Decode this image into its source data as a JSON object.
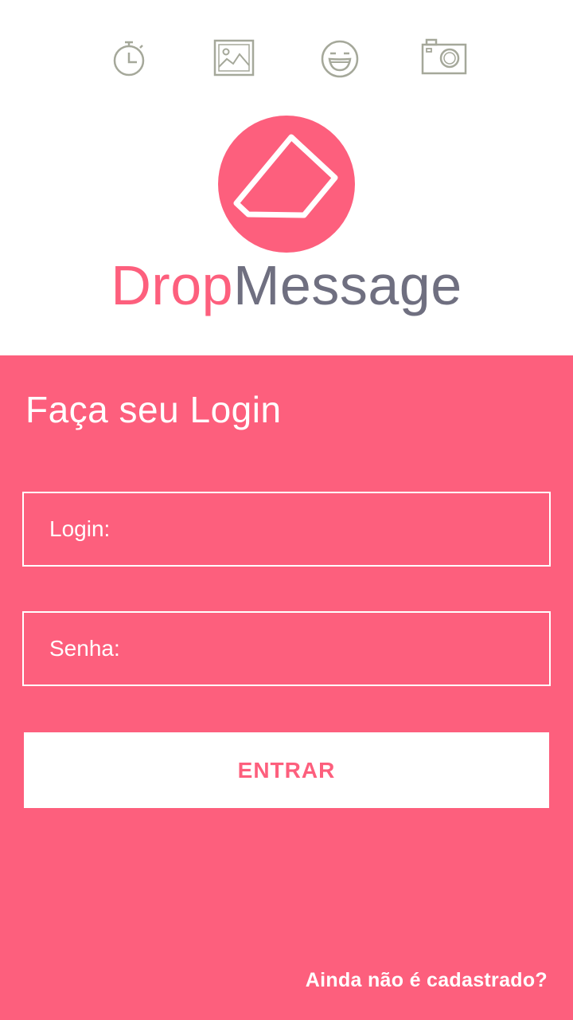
{
  "colors": {
    "accent": "#FD5F7D",
    "brand_secondary": "#6F6F80",
    "icon_gray": "#A5A89A",
    "white": "#FFFFFF"
  },
  "icons": [
    "timer-icon",
    "image-icon",
    "smiley-icon",
    "camera-icon"
  ],
  "brand": {
    "part1": "Drop",
    "part2": "Message"
  },
  "login_form": {
    "title": "Faça seu Login",
    "login_label": "Login:",
    "password_label": "Senha:",
    "submit_label": "ENTRAR",
    "register_link": "Ainda não é cadastrado?"
  }
}
